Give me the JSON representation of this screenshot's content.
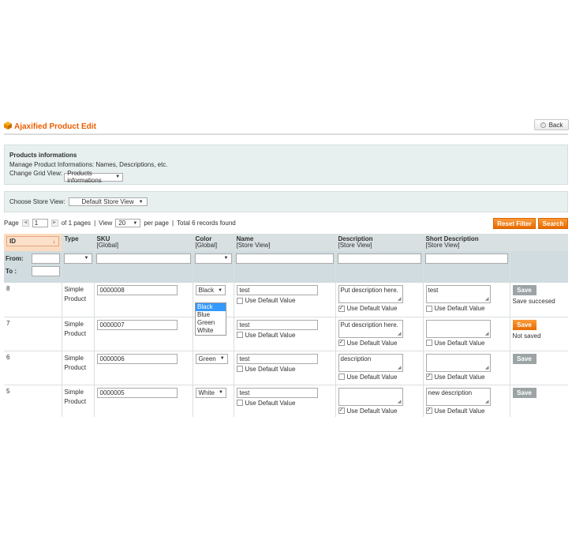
{
  "page": {
    "title": "Ajaxified Product Edit",
    "back_label": "Back"
  },
  "info_box": {
    "title": "Products informations",
    "desc": "Manage Product Informations: Names, Descriptions, etc.",
    "grid_view_label": "Change Grid View:",
    "grid_view_value": "Products informations"
  },
  "store_box": {
    "label": "Choose Store View:",
    "value": "Default Store View"
  },
  "pager": {
    "page_label": "Page",
    "page_value": "1",
    "of_pages": "of 1 pages",
    "sep": "|",
    "view_label": "View",
    "per_page_value": "20",
    "per_page_label": "per page",
    "total": "Total 6 records found"
  },
  "buttons": {
    "reset_filter": "Reset Filter",
    "search": "Search",
    "save": "Save"
  },
  "columns": {
    "id": "ID",
    "type": "Type",
    "sku": "SKU",
    "sku_scope": "[Global]",
    "color": "Color",
    "color_scope": "[Global]",
    "name": "Name",
    "name_scope": "[Store View]",
    "description": "Description",
    "description_scope": "[Store View]",
    "short_description": "Short Description",
    "short_description_scope": "[Store View]"
  },
  "filter": {
    "from": "From:",
    "to": "To :"
  },
  "use_default_label": "Use Default Value",
  "color_options": [
    "Black",
    "Blue",
    "Green",
    "White"
  ],
  "rows": [
    {
      "id": "8",
      "type_line1": "Simple",
      "type_line2": "Product",
      "sku": "0000008",
      "color": "Black",
      "name": "test",
      "name_default": false,
      "description": "Put description here.",
      "description_default": true,
      "short_description": "test",
      "short_default": false,
      "save_style": "grey",
      "save_message": "Save succesed"
    },
    {
      "id": "7",
      "type_line1": "Simple",
      "type_line2": "Product",
      "sku": "0000007",
      "color": "",
      "name": "test",
      "name_default": false,
      "description": "Put description here.",
      "description_default": true,
      "short_description": "",
      "short_default": false,
      "save_style": "orange",
      "save_message": "Not saved"
    },
    {
      "id": "6",
      "type_line1": "Simple",
      "type_line2": "Product",
      "sku": "0000006",
      "color": "Green",
      "name": "test",
      "name_default": false,
      "description": "description",
      "description_default": false,
      "short_description": "",
      "short_default": true,
      "save_style": "grey",
      "save_message": ""
    },
    {
      "id": "5",
      "type_line1": "Simple",
      "type_line2": "Product",
      "sku": "0000005",
      "color": "White",
      "name": "test",
      "name_default": false,
      "description": "",
      "description_default": true,
      "short_description": "new description",
      "short_default": true,
      "save_style": "grey",
      "save_message": ""
    }
  ],
  "accent_color": "#eb5e00",
  "highlight_color": "#3399ff"
}
